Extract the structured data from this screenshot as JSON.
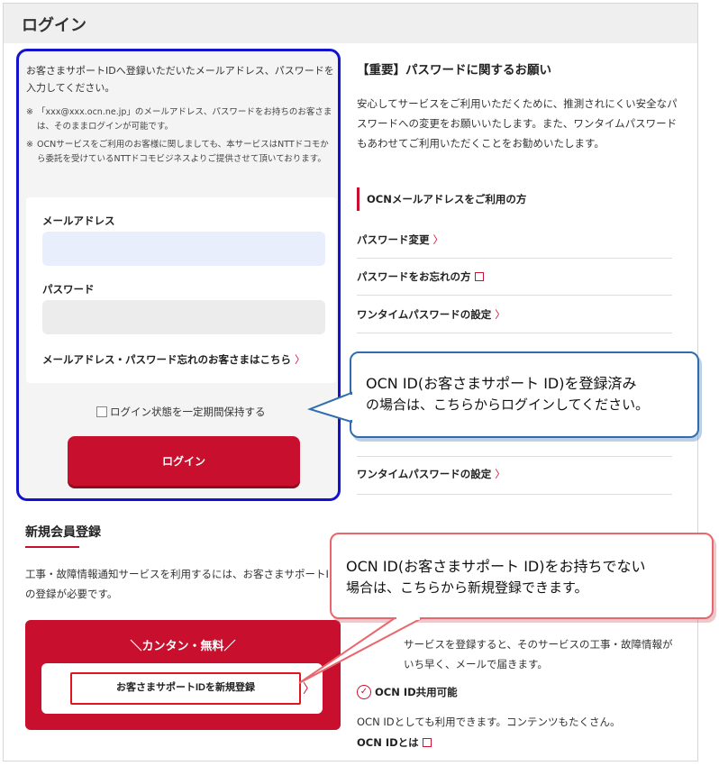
{
  "header": {
    "title": "ログイン"
  },
  "login": {
    "intro": "お客さまサポートIDへ登録いただいたメールアドレス、パスワードを入力してください。",
    "note_mark": "※",
    "note1": "「xxx@xxx.ocn.ne.jp」のメールアドレス、パスワードをお持ちのお客さまは、そのままログインが可能です。",
    "note2": "OCNサービスをご利用のお客様に関しましても、本サービスはNTTドコモから委託を受けているNTTドコモビジネスよりご提供させて頂いております。",
    "email_label": "メールアドレス",
    "email_value": "",
    "password_label": "パスワード",
    "password_value": "",
    "forgot_link": "メールアドレス・パスワード忘れのお客さまはこちら",
    "chevron": "〉",
    "remember_label": "ログイン状態を一定期間保持する",
    "remember_checked": false,
    "login_button": "ログイン"
  },
  "notice": {
    "title": "【重要】パスワードに関するお願い",
    "body": "安心してサービスをご利用いただくために、推測されにくい安全なパスワードへの変更をお願いいたします。また、ワンタイムパスワードもあわせてご利用いただくことをお勧めいたします。",
    "section_ocn": "OCNメールアドレスをご利用の方",
    "link_change_pw": "パスワード変更",
    "link_forgot_pw": "パスワードをお忘れの方",
    "link_onetime_1": "ワンタイムパスワードの設定",
    "link_onetime_2": "ワンタイムパスワードの設定"
  },
  "signup": {
    "title": "新規会員登録",
    "desc": "工事・故障情報通知サービスを利用するには、お客さまサポートIDの登録が必要です。",
    "promo": "＼カンタン・無料／",
    "button": "お客さまサポートIDを新規登録",
    "service_text": "サービスを登録すると、そのサービスの工事・故障情報がいち早く、メールで届きます。",
    "share_label": "OCN ID共用可能",
    "ocn_id_text": "OCN IDとしても利用できます。コンテンツもたくさん。",
    "ocn_id_link": "OCN IDとは"
  },
  "callouts": {
    "blue_line1": "OCN ID(お客さまサポート ID)を登録済み",
    "blue_line2": "の場合は、こちらからログインしてください。",
    "pink_line1": "OCN ID(お客さまサポート ID)をお持ちでない",
    "pink_line2": "場合は、こちらから新規登録できます。"
  },
  "colors": {
    "accent_red": "#c8102e",
    "login_highlight": "#1313cf",
    "callout_blue": "#2e6eb0",
    "callout_pink": "#e9676c"
  },
  "icons": [
    "chevron-right-icon",
    "external-link-icon",
    "checkbox-icon",
    "check-circle-icon"
  ]
}
